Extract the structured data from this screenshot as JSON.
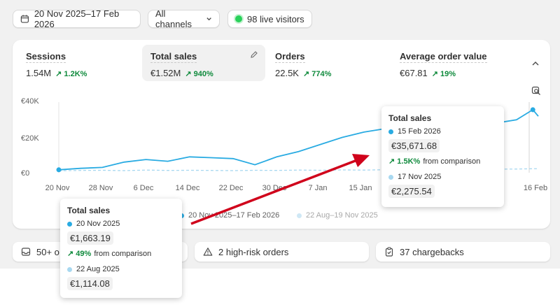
{
  "toolbar": {
    "date_range": "20 Nov 2025–17 Feb 2026",
    "channel": "All channels",
    "live_visitors": "98 live visitors"
  },
  "metrics": [
    {
      "label": "Sessions",
      "value": "1.54M",
      "change": "1.2K%"
    },
    {
      "label": "Total sales",
      "value": "€1.52M",
      "change": "940%"
    },
    {
      "label": "Orders",
      "value": "22.5K",
      "change": "774%"
    },
    {
      "label": "Average order value",
      "value": "€67.81",
      "change": "19%"
    }
  ],
  "chart": {
    "y_ticks": [
      "€40K",
      "€20K",
      "€0"
    ],
    "x_ticks": [
      "20 Nov",
      "28 Nov",
      "6 Dec",
      "14 Dec",
      "22 Dec",
      "30 Dec",
      "7 Jan",
      "15 Jan",
      "16 Feb"
    ],
    "legend": [
      "20 Nov 2025–17 Feb 2026",
      "22 Aug–19 Nov 2025"
    ]
  },
  "chart_data": {
    "type": "line",
    "ylim": [
      0,
      40000
    ],
    "series": [
      {
        "name": "20 Nov 2025–17 Feb 2026",
        "color": "#29abe2",
        "x": [
          "2025-11-20",
          "2025-11-24",
          "2025-11-28",
          "2025-12-02",
          "2025-12-06",
          "2025-12-10",
          "2025-12-14",
          "2025-12-18",
          "2025-12-22",
          "2025-12-26",
          "2025-12-30",
          "2026-01-03",
          "2026-01-07",
          "2026-01-11",
          "2026-01-15",
          "2026-01-19",
          "2026-01-23",
          "2026-01-27",
          "2026-01-31",
          "2026-02-04",
          "2026-02-08",
          "2026-02-12",
          "2026-02-15",
          "2026-02-16"
        ],
        "values": [
          1663,
          2500,
          3000,
          6000,
          7500,
          6500,
          9000,
          8500,
          8000,
          4500,
          9000,
          12000,
          16000,
          20000,
          23000,
          25000,
          28000,
          27000,
          26000,
          29000,
          28000,
          30000,
          35672,
          32000
        ]
      },
      {
        "name": "22 Aug–19 Nov 2025",
        "color": "#a8d8f0",
        "x": [
          "2025-11-20",
          "2025-11-24",
          "2025-11-28",
          "2025-12-02",
          "2025-12-06",
          "2025-12-10",
          "2025-12-14",
          "2025-12-18",
          "2025-12-22",
          "2025-12-26",
          "2025-12-30",
          "2026-01-03",
          "2026-01-07",
          "2026-01-11",
          "2026-01-15",
          "2026-01-19",
          "2026-01-23",
          "2026-01-27",
          "2026-01-31",
          "2026-02-04",
          "2026-02-08",
          "2026-02-12",
          "2026-02-15",
          "2026-02-16"
        ],
        "values": [
          1114,
          1300,
          1400,
          1200,
          1500,
          1300,
          1400,
          1300,
          1200,
          1400,
          1300,
          1500,
          1400,
          1600,
          1500,
          1700,
          1600,
          1800,
          1700,
          1900,
          2000,
          2100,
          2276,
          2300
        ]
      }
    ]
  },
  "tooltip_right": {
    "title": "Total sales",
    "date1": "15 Feb 2026",
    "value1": "€35,671.68",
    "change": "1.5K%",
    "change_text": "from comparison",
    "date2": "17 Nov 2025",
    "value2": "€2,275.54"
  },
  "tooltip_left": {
    "title": "Total sales",
    "date1": "20 Nov 2025",
    "value1": "€1,663.19",
    "change": "49%",
    "change_text": "from comparison",
    "date2": "22 Aug 2025",
    "value2": "€1,114.08"
  },
  "bottom": {
    "item1": "50+ o",
    "item2": "2 high-risk orders",
    "item3": "37 chargebacks"
  },
  "colors": {
    "accent": "#29abe2",
    "positive": "#0f8a3c",
    "arrow": "#d0021b"
  }
}
